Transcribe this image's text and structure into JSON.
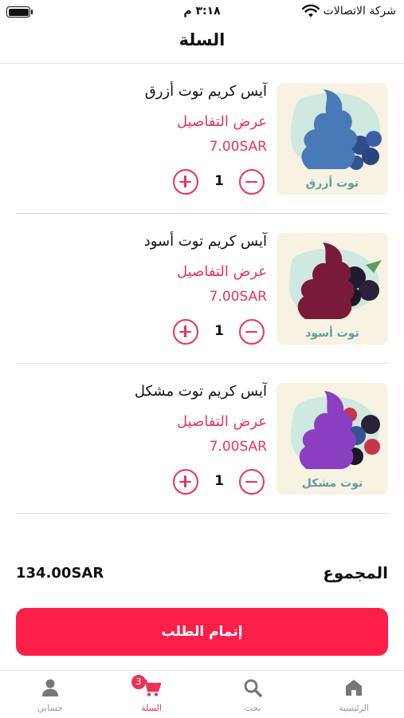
{
  "status_bar": {
    "carrier": "شركة الاتصالات",
    "time": "٣:١٨ م"
  },
  "header": {
    "title": "السلة"
  },
  "cart": {
    "items": [
      {
        "name": "آيس كريم توت أزرق",
        "details_link": "عرض التفاصيل",
        "price": "7.00SAR",
        "quantity": "1",
        "image_label": "توت أزرق",
        "cream_color": "#4a79b8",
        "blob_color": "#cfe8e0",
        "label_color": "#5b9fa2"
      },
      {
        "name": "آيس كريم توت أسود",
        "details_link": "عرض التفاصيل",
        "price": "7.00SAR",
        "quantity": "1",
        "image_label": "توت أسود",
        "cream_color": "#7a1a3a",
        "blob_color": "#cfe8e0",
        "label_color": "#5b9fa2"
      },
      {
        "name": "آيس كريم توت مشكل",
        "details_link": "عرض التفاصيل",
        "price": "7.00SAR",
        "quantity": "1",
        "image_label": "توت مشكل",
        "cream_color": "#8a3fc0",
        "blob_color": "#cfe8e0",
        "label_color": "#5b9fa2"
      }
    ]
  },
  "total": {
    "label": "المجموع",
    "value": "134.00SAR"
  },
  "checkout": {
    "label": "إتمام الطلب"
  },
  "tab_bar": {
    "home": "الرئيسية",
    "search": "بحث",
    "cart": "السلة",
    "cart_badge": "3",
    "account": "حسابي"
  },
  "colors": {
    "accent": "#e8345a",
    "checkout_bg": "#fb1f4a"
  }
}
